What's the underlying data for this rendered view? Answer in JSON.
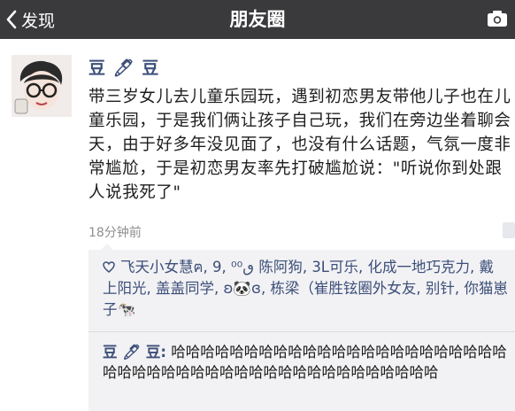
{
  "nav": {
    "back_label": "发现",
    "title": "朋友圈",
    "icons": {
      "back": "chevron-left-icon",
      "camera": "camera-icon"
    }
  },
  "post": {
    "author": "豆 🖊 豆",
    "content": "带三岁女儿去儿童乐园玩，遇到初恋男友带他儿子也在儿童乐园，于是我们俩让孩子自己玩，我们在旁边坐着聊会天，由于好多年没见面了，也没有什么话题，气氛一度非常尴尬，于是初恋男友率先打破尴尬说：\"听说你到处跟人说我死了\"",
    "time": "18分钟前"
  },
  "likes": {
    "icon": "heart-outline-icon",
    "text": "飞天小女慧ฅ, 9, ⁰ٯ⁰ 陈阿狗, 3L可乐, 化成一地巧克力, 戴上阳光, 盖盖同学, ʚ🐼ɞ, 栋梁（崔胜铉圈外女友, 别针, 你猫崽子🐄"
  },
  "comment": {
    "author": "豆 🖊 豆:",
    "text": "哈哈哈哈哈哈哈哈哈哈哈哈哈哈哈哈哈哈哈哈哈哈哈哈哈哈哈哈哈哈哈哈哈哈哈哈哈哈哈哈哈哈哈哈哈哈"
  },
  "colors": {
    "navbar": "#3a3a3c",
    "name_blue": "#3d4f7a",
    "comment_bg": "#f2f2f4"
  }
}
